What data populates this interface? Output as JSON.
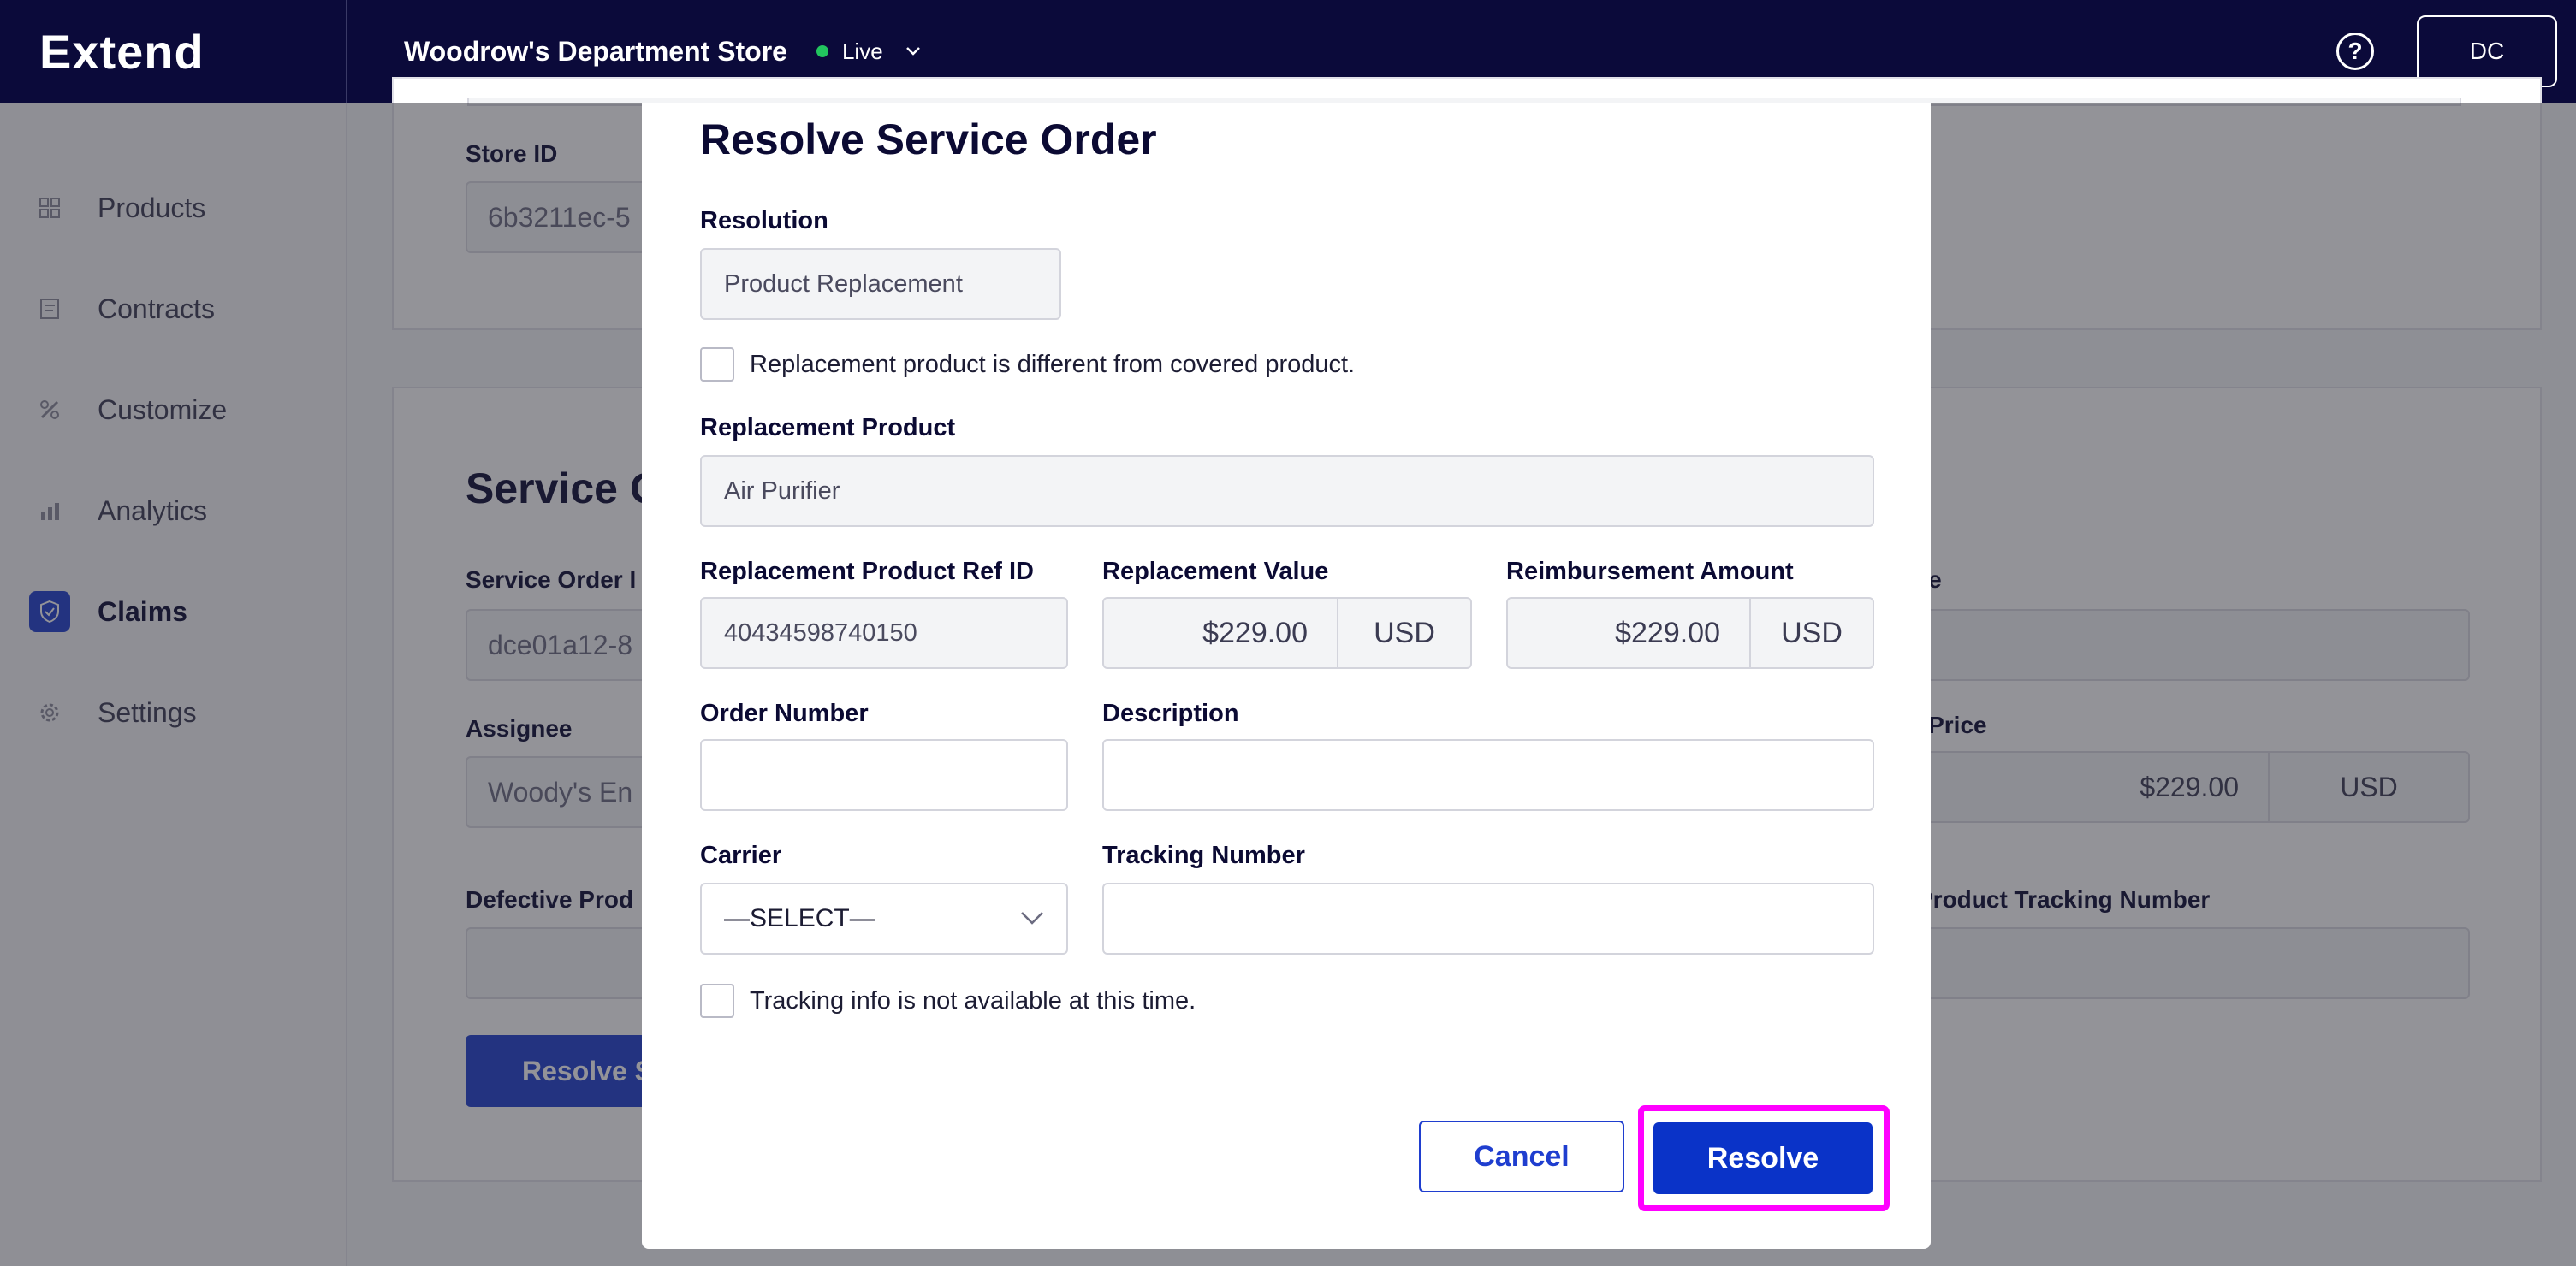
{
  "header": {
    "logo": "Extend",
    "store_name": "Woodrow's Department Store",
    "status": "Live",
    "help_glyph": "?",
    "avatar_initials": "DC"
  },
  "sidebar": {
    "items": [
      {
        "label": "Products",
        "icon": "grid-icon"
      },
      {
        "label": "Contracts",
        "icon": "document-icon"
      },
      {
        "label": "Customize",
        "icon": "tools-icon"
      },
      {
        "label": "Analytics",
        "icon": "chart-icon"
      },
      {
        "label": "Claims",
        "icon": "shield-icon",
        "active": true
      },
      {
        "label": "Settings",
        "icon": "gear-icon"
      }
    ]
  },
  "background": {
    "store_id_label": "Store ID",
    "store_id_value": "6b3211ec-5",
    "section_title": "Service O",
    "service_order_label": "Service Order I",
    "service_order_value": "dce01a12-8",
    "assignee_label": "Assignee",
    "assignee_value": "Woody's En",
    "defective_label": "Defective Prod",
    "resolve_btn": "Resolve S",
    "right_type_label": "pe",
    "right_price_label": "t Price",
    "right_price_value": "$229.00",
    "right_price_currency": "USD",
    "right_tracking_label": "Product Tracking Number"
  },
  "modal": {
    "title": "Resolve Service Order",
    "resolution_label": "Resolution",
    "resolution_value": "Product Replacement",
    "different_product_label": "Replacement product is different from covered product.",
    "replacement_product_label": "Replacement Product",
    "replacement_product_value": "Air Purifier",
    "ref_id_label": "Replacement Product Ref ID",
    "ref_id_value": "40434598740150",
    "replacement_value_label": "Replacement Value",
    "replacement_value_amount": "$229.00",
    "replacement_value_currency": "USD",
    "reimbursement_label": "Reimbursement Amount",
    "reimbursement_amount": "$229.00",
    "reimbursement_currency": "USD",
    "order_number_label": "Order Number",
    "order_number_value": "",
    "description_label": "Description",
    "description_value": "",
    "carrier_label": "Carrier",
    "carrier_value": "—SELECT—",
    "tracking_number_label": "Tracking Number",
    "tracking_number_value": "",
    "tracking_unavailable_label": "Tracking info is not available at this time.",
    "cancel_label": "Cancel",
    "resolve_label": "Resolve"
  },
  "colors": {
    "topbar": "#0b0a3a",
    "primary": "#1f3ecf",
    "highlight": "#ff00ff",
    "live": "#22c55e"
  }
}
